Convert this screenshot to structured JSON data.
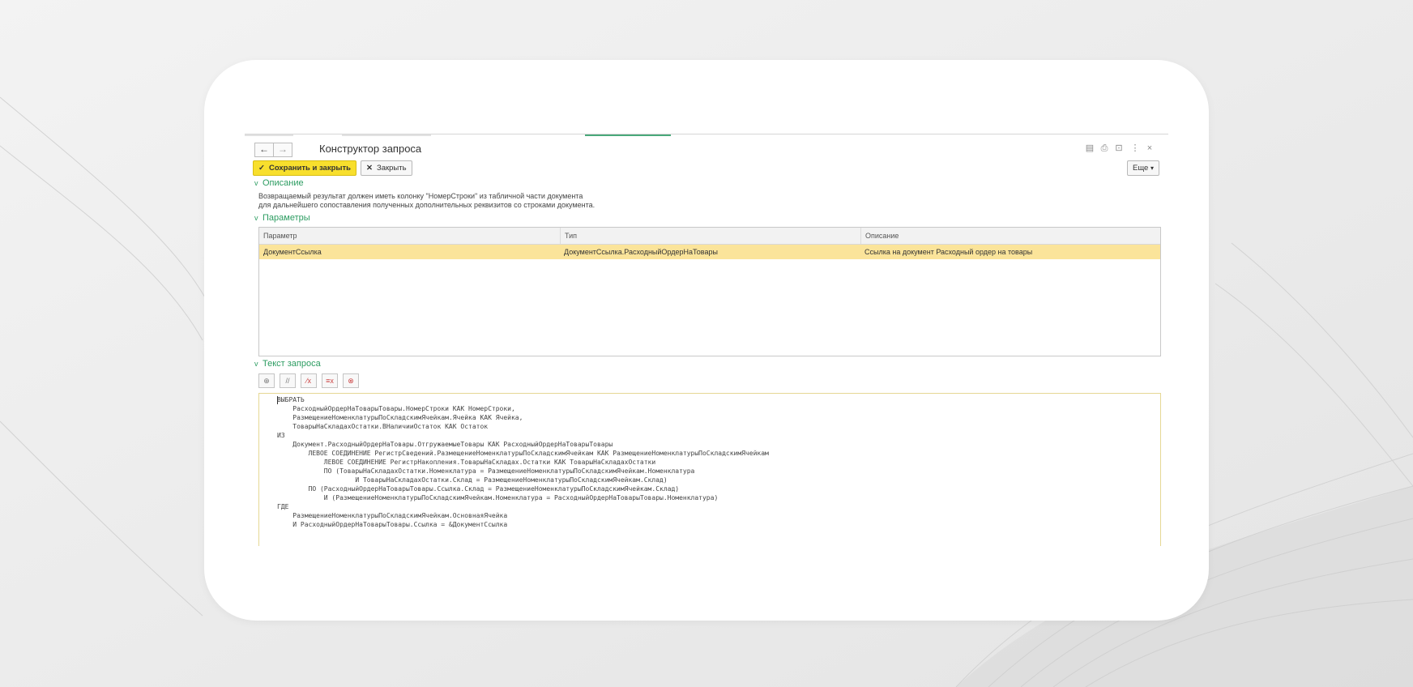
{
  "window": {
    "title": "Конструктор запроса",
    "back_icon": "←",
    "forward_icon": "→",
    "title_icons": [
      "save-icon",
      "print-icon",
      "preview-icon",
      "menu-dots-icon",
      "close-icon"
    ],
    "title_icon_glyphs": [
      "▤",
      "⎙",
      "⊡",
      "⋮",
      "×"
    ]
  },
  "toolbar": {
    "save_close_label": "Сохранить и закрыть",
    "close_label": "Закрыть",
    "more_label": "Еще",
    "more_caret": "▾",
    "close_glyph": "✕",
    "save_glyph": "✓"
  },
  "description_section": {
    "title": "Описание",
    "chevron": "v",
    "line1": "Возвращаемый результат должен иметь колонку \"НомерСтроки\" из табличной части документа",
    "line2": "для дальнейшего сопоставления полученных дополнительных реквизитов со строками документа."
  },
  "parameters_section": {
    "title": "Параметры",
    "chevron": "v",
    "columns": [
      "Параметр",
      "Тип",
      "Описание"
    ],
    "rows": [
      [
        "ДокументСсылка",
        "ДокументСсылка.РасходныйОрдерНаТовары",
        "Ссылка на документ Расходный ордер на товары"
      ]
    ]
  },
  "query_section": {
    "title": "Текст запроса",
    "chevron": "v",
    "tools": [
      "query-builder-icon",
      "comment-icon",
      "uncomment-icon",
      "format-icon",
      "delete-icon"
    ],
    "tool_glyphs": [
      "⊕",
      "//",
      "⁄x",
      "≡x",
      "⊗"
    ],
    "lines": [
      "ВЫБРАТЬ",
      "    РасходныйОрдерНаТоварыТовары.НомерСтроки КАК НомерСтроки,",
      "    РазмещениеНоменклатурыПоСкладскимЯчейкам.Ячейка КАК Ячейка,",
      "    ТоварыНаСкладахОстатки.ВНаличииОстаток КАК Остаток",
      "ИЗ",
      "    Документ.РасходныйОрдерНаТовары.ОтгружаемыеТовары КАК РасходныйОрдерНаТоварыТовары",
      "        ЛЕВОЕ СОЕДИНЕНИЕ РегистрСведений.РазмещениеНоменклатурыПоСкладскимЯчейкам КАК РазмещениеНоменклатурыПоСкладскимЯчейкам",
      "            ЛЕВОЕ СОЕДИНЕНИЕ РегистрНакопления.ТоварыНаСкладах.Остатки КАК ТоварыНаСкладахОстатки",
      "            ПО (ТоварыНаСкладахОстатки.Номенклатура = РазмещениеНоменклатурыПоСкладскимЯчейкам.Номенклатура",
      "                    И ТоварыНаСкладахОстатки.Склад = РазмещениеНоменклатурыПоСкладскимЯчейкам.Склад)",
      "        ПО (РасходныйОрдерНаТоварыТовары.Ссылка.Склад = РазмещениеНоменклатурыПоСкладскимЯчейкам.Склад)",
      "            И (РазмещениеНоменклатурыПоСкладскимЯчейкам.Номенклатура = РасходныйОрдерНаТоварыТовары.Номенклатура)",
      "ГДЕ",
      "    РазмещениеНоменклатурыПоСкладскимЯчейкам.ОсновнаяЯчейка",
      "    И РасходныйОрдерНаТоварыТовары.Ссылка = &ДокументСсылка"
    ]
  },
  "colors": {
    "accent_green": "#2c9c61",
    "primary_button": "#f8df2d",
    "selected_row": "#fbe49a"
  }
}
